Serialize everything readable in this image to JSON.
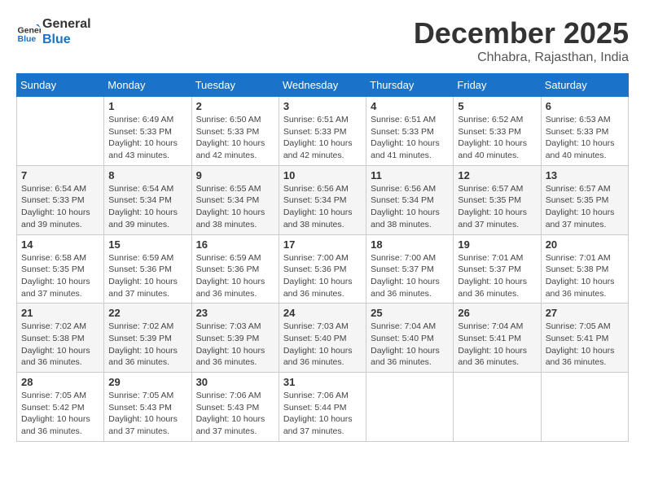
{
  "header": {
    "logo_line1": "General",
    "logo_line2": "Blue",
    "month": "December 2025",
    "location": "Chhabra, Rajasthan, India"
  },
  "days_of_week": [
    "Sunday",
    "Monday",
    "Tuesday",
    "Wednesday",
    "Thursday",
    "Friday",
    "Saturday"
  ],
  "weeks": [
    [
      {
        "day": "",
        "info": ""
      },
      {
        "day": "1",
        "info": "Sunrise: 6:49 AM\nSunset: 5:33 PM\nDaylight: 10 hours\nand 43 minutes."
      },
      {
        "day": "2",
        "info": "Sunrise: 6:50 AM\nSunset: 5:33 PM\nDaylight: 10 hours\nand 42 minutes."
      },
      {
        "day": "3",
        "info": "Sunrise: 6:51 AM\nSunset: 5:33 PM\nDaylight: 10 hours\nand 42 minutes."
      },
      {
        "day": "4",
        "info": "Sunrise: 6:51 AM\nSunset: 5:33 PM\nDaylight: 10 hours\nand 41 minutes."
      },
      {
        "day": "5",
        "info": "Sunrise: 6:52 AM\nSunset: 5:33 PM\nDaylight: 10 hours\nand 40 minutes."
      },
      {
        "day": "6",
        "info": "Sunrise: 6:53 AM\nSunset: 5:33 PM\nDaylight: 10 hours\nand 40 minutes."
      }
    ],
    [
      {
        "day": "7",
        "info": "Sunrise: 6:54 AM\nSunset: 5:33 PM\nDaylight: 10 hours\nand 39 minutes."
      },
      {
        "day": "8",
        "info": "Sunrise: 6:54 AM\nSunset: 5:34 PM\nDaylight: 10 hours\nand 39 minutes."
      },
      {
        "day": "9",
        "info": "Sunrise: 6:55 AM\nSunset: 5:34 PM\nDaylight: 10 hours\nand 38 minutes."
      },
      {
        "day": "10",
        "info": "Sunrise: 6:56 AM\nSunset: 5:34 PM\nDaylight: 10 hours\nand 38 minutes."
      },
      {
        "day": "11",
        "info": "Sunrise: 6:56 AM\nSunset: 5:34 PM\nDaylight: 10 hours\nand 38 minutes."
      },
      {
        "day": "12",
        "info": "Sunrise: 6:57 AM\nSunset: 5:35 PM\nDaylight: 10 hours\nand 37 minutes."
      },
      {
        "day": "13",
        "info": "Sunrise: 6:57 AM\nSunset: 5:35 PM\nDaylight: 10 hours\nand 37 minutes."
      }
    ],
    [
      {
        "day": "14",
        "info": "Sunrise: 6:58 AM\nSunset: 5:35 PM\nDaylight: 10 hours\nand 37 minutes."
      },
      {
        "day": "15",
        "info": "Sunrise: 6:59 AM\nSunset: 5:36 PM\nDaylight: 10 hours\nand 37 minutes."
      },
      {
        "day": "16",
        "info": "Sunrise: 6:59 AM\nSunset: 5:36 PM\nDaylight: 10 hours\nand 36 minutes."
      },
      {
        "day": "17",
        "info": "Sunrise: 7:00 AM\nSunset: 5:36 PM\nDaylight: 10 hours\nand 36 minutes."
      },
      {
        "day": "18",
        "info": "Sunrise: 7:00 AM\nSunset: 5:37 PM\nDaylight: 10 hours\nand 36 minutes."
      },
      {
        "day": "19",
        "info": "Sunrise: 7:01 AM\nSunset: 5:37 PM\nDaylight: 10 hours\nand 36 minutes."
      },
      {
        "day": "20",
        "info": "Sunrise: 7:01 AM\nSunset: 5:38 PM\nDaylight: 10 hours\nand 36 minutes."
      }
    ],
    [
      {
        "day": "21",
        "info": "Sunrise: 7:02 AM\nSunset: 5:38 PM\nDaylight: 10 hours\nand 36 minutes."
      },
      {
        "day": "22",
        "info": "Sunrise: 7:02 AM\nSunset: 5:39 PM\nDaylight: 10 hours\nand 36 minutes."
      },
      {
        "day": "23",
        "info": "Sunrise: 7:03 AM\nSunset: 5:39 PM\nDaylight: 10 hours\nand 36 minutes."
      },
      {
        "day": "24",
        "info": "Sunrise: 7:03 AM\nSunset: 5:40 PM\nDaylight: 10 hours\nand 36 minutes."
      },
      {
        "day": "25",
        "info": "Sunrise: 7:04 AM\nSunset: 5:40 PM\nDaylight: 10 hours\nand 36 minutes."
      },
      {
        "day": "26",
        "info": "Sunrise: 7:04 AM\nSunset: 5:41 PM\nDaylight: 10 hours\nand 36 minutes."
      },
      {
        "day": "27",
        "info": "Sunrise: 7:05 AM\nSunset: 5:41 PM\nDaylight: 10 hours\nand 36 minutes."
      }
    ],
    [
      {
        "day": "28",
        "info": "Sunrise: 7:05 AM\nSunset: 5:42 PM\nDaylight: 10 hours\nand 36 minutes."
      },
      {
        "day": "29",
        "info": "Sunrise: 7:05 AM\nSunset: 5:43 PM\nDaylight: 10 hours\nand 37 minutes."
      },
      {
        "day": "30",
        "info": "Sunrise: 7:06 AM\nSunset: 5:43 PM\nDaylight: 10 hours\nand 37 minutes."
      },
      {
        "day": "31",
        "info": "Sunrise: 7:06 AM\nSunset: 5:44 PM\nDaylight: 10 hours\nand 37 minutes."
      },
      {
        "day": "",
        "info": ""
      },
      {
        "day": "",
        "info": ""
      },
      {
        "day": "",
        "info": ""
      }
    ]
  ]
}
